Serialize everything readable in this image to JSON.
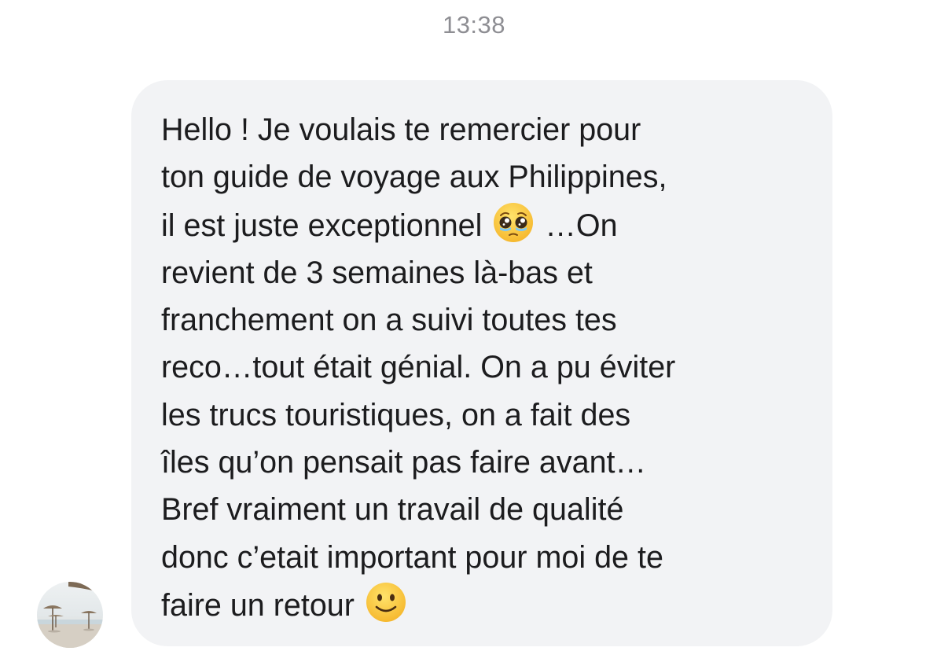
{
  "chat": {
    "timestamp": "13:38",
    "message": {
      "lines": [
        "Hello ! Je voulais te remercier pour",
        "ton guide de voyage aux Philippines,",
        "il est juste exceptionnel",
        "…On",
        "revient de 3 semaines là-bas et",
        "franchement on a suivi toutes tes",
        "reco…tout était génial. On a pu éviter",
        "les trucs touristiques, on a fait des",
        "îles qu’on pensait pas faire avant…",
        "Bref vraiment un travail de qualité",
        "donc c’etait important pour moi de te",
        "faire un retour"
      ],
      "emojis": [
        "pleading-face-emoji",
        "slightly-smiling-face-emoji"
      ]
    },
    "sender": {
      "avatar_icon": "beach-umbrellas-avatar"
    },
    "colors": {
      "bubble_background": "#f2f3f5",
      "text": "#1c1c1e",
      "timestamp": "#8e8e93"
    }
  }
}
